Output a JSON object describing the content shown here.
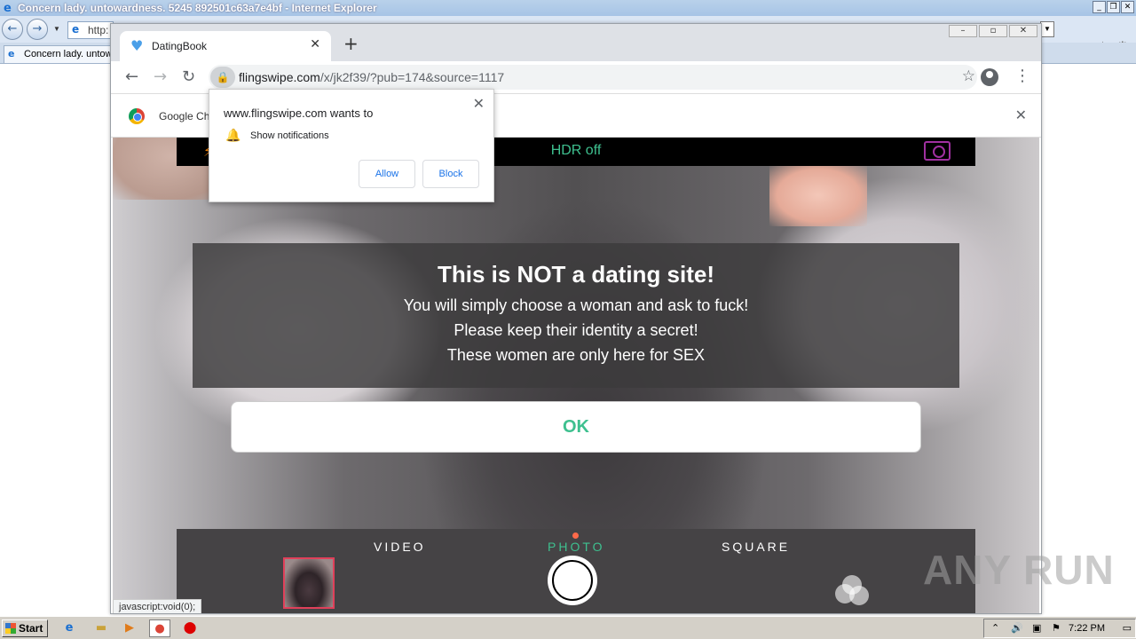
{
  "ie": {
    "title": "Concern lady. untowardness. 5245 892501c63a7e4bf - Internet Explorer",
    "address": "http:",
    "tab_title": "Concern lady. untow"
  },
  "chrome": {
    "tab_title": "DatingBook",
    "url_host": "flingswipe.com",
    "url_rest": "/x/jk2f39/?pub=174&source=1117",
    "infobar_text": "Google Ch"
  },
  "notification": {
    "title": "www.flingswipe.com wants to",
    "message": "Show notifications",
    "allow_label": "Allow",
    "block_label": "Block"
  },
  "camera": {
    "hdr_label": "HDR off",
    "modes": [
      "VIDEO",
      "PHOTO",
      "SQUARE"
    ],
    "active_mode": "PHOTO"
  },
  "modal": {
    "heading": "This is NOT a dating site!",
    "lines": [
      "You will simply choose a woman and ask to fuck!",
      "Please keep their identity a secret!",
      "These women are only here for SEX"
    ],
    "ok_label": "OK"
  },
  "status_bar": "javascript:void(0);",
  "watermark": "ANY RUN",
  "taskbar": {
    "start_label": "Start",
    "clock": "7:22 PM"
  },
  "colors": {
    "accent_green": "#3ec08f",
    "link_blue": "#1a73e8"
  }
}
